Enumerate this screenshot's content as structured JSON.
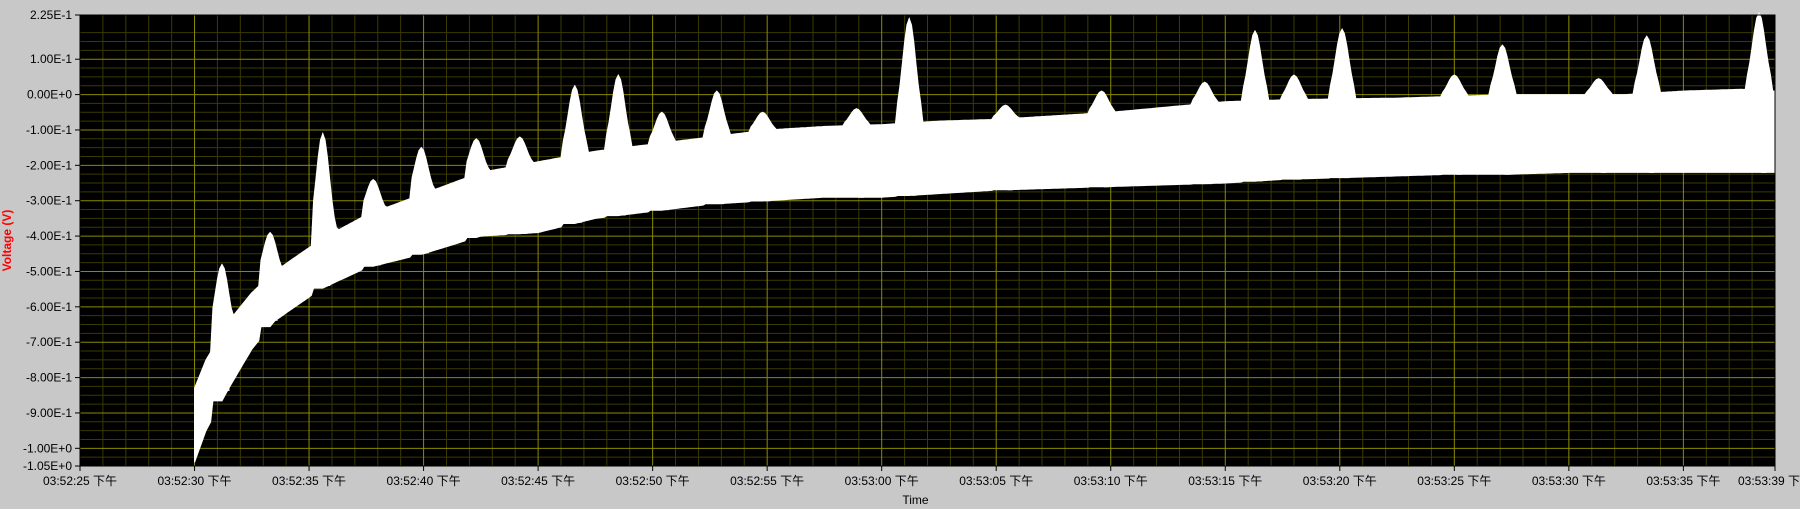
{
  "colors": {
    "background": "#c8c8c8",
    "plot_area": "#000000",
    "grid_major": "#8a8a00",
    "grid_minor": "#3a3a00",
    "trace": "#ffffff",
    "ylabel": "#ff0000",
    "tick_text": "#000000"
  },
  "chart_data": {
    "type": "area",
    "xlabel": "Time",
    "ylabel": "Voltage (V)",
    "x_range_seconds": [
      "03:52:25",
      "03:53:39"
    ],
    "ylim": [
      -1.05,
      0.225
    ],
    "grid": true,
    "y_ticks": [
      {
        "value": 0.225,
        "label": "2.25E-1"
      },
      {
        "value": 0.1,
        "label": "1.00E-1"
      },
      {
        "value": 0.0,
        "label": "0.00E+0"
      },
      {
        "value": -0.1,
        "label": "-1.00E-1"
      },
      {
        "value": -0.2,
        "label": "-2.00E-1"
      },
      {
        "value": -0.3,
        "label": "-3.00E-1"
      },
      {
        "value": -0.4,
        "label": "-4.00E-1"
      },
      {
        "value": -0.5,
        "label": "-5.00E-1"
      },
      {
        "value": -0.6,
        "label": "-6.00E-1"
      },
      {
        "value": -0.7,
        "label": "-7.00E-1"
      },
      {
        "value": -0.8,
        "label": "-8.00E-1"
      },
      {
        "value": -0.9,
        "label": "-9.00E-1"
      },
      {
        "value": -1.0,
        "label": "-1.00E+0"
      },
      {
        "value": -1.05,
        "label": "-1.05E+0"
      }
    ],
    "x_ticks": [
      {
        "time": "03:52:25",
        "label": "03:52:25 下午"
      },
      {
        "time": "03:52:30",
        "label": "03:52:30 下午"
      },
      {
        "time": "03:52:35",
        "label": "03:52:35 下午"
      },
      {
        "time": "03:52:40",
        "label": "03:52:40 下午"
      },
      {
        "time": "03:52:45",
        "label": "03:52:45 下午"
      },
      {
        "time": "03:52:50",
        "label": "03:52:50 下午"
      },
      {
        "time": "03:52:55",
        "label": "03:52:55 下午"
      },
      {
        "time": "03:53:00",
        "label": "03:53:00 下午"
      },
      {
        "time": "03:53:05",
        "label": "03:53:05 下午"
      },
      {
        "time": "03:53:10",
        "label": "03:53:10 下午"
      },
      {
        "time": "03:53:15",
        "label": "03:53:15 下午"
      },
      {
        "time": "03:53:20",
        "label": "03:53:20 下午"
      },
      {
        "time": "03:53:25",
        "label": "03:53:25 下午"
      },
      {
        "time": "03:53:30",
        "label": "03:53:30 下午"
      },
      {
        "time": "03:53:35",
        "label": "03:53:35 下午"
      },
      {
        "time": "03:53:39",
        "label": "03:53:39 下午"
      }
    ],
    "envelope": {
      "t_seconds_from_start": [
        5.0,
        5.5,
        6.5,
        7.5,
        8.5,
        10.5,
        12.5,
        15.0,
        17.5,
        20.0,
        22.5,
        25.0,
        27.5,
        30.0,
        32.5,
        35.0,
        37.5,
        40.0,
        42.5,
        45.0,
        47.5,
        50.0,
        52.5,
        55.0,
        57.5,
        60.0,
        62.5,
        65.0,
        67.5,
        70.0,
        72.5,
        74.0
      ],
      "upper": [
        -0.83,
        -0.75,
        -0.64,
        -0.56,
        -0.5,
        -0.41,
        -0.34,
        -0.28,
        -0.22,
        -0.19,
        -0.16,
        -0.14,
        -0.12,
        -0.1,
        -0.09,
        -0.085,
        -0.075,
        -0.07,
        -0.06,
        -0.05,
        -0.035,
        -0.02,
        -0.015,
        -0.012,
        -0.01,
        -0.005,
        0.0,
        0.0,
        0.0,
        0.01,
        0.015,
        0.01
      ],
      "lower": [
        -1.04,
        -0.95,
        -0.83,
        -0.72,
        -0.64,
        -0.55,
        -0.49,
        -0.45,
        -0.4,
        -0.39,
        -0.35,
        -0.33,
        -0.31,
        -0.3,
        -0.29,
        -0.29,
        -0.28,
        -0.27,
        -0.265,
        -0.26,
        -0.255,
        -0.25,
        -0.24,
        -0.235,
        -0.23,
        -0.225,
        -0.225,
        -0.22,
        -0.22,
        -0.22,
        -0.22,
        -0.22
      ]
    },
    "spikes": [
      {
        "t": 6.2,
        "peak": -0.48
      },
      {
        "t": 8.3,
        "peak": -0.39
      },
      {
        "t": 10.6,
        "peak": -0.11
      },
      {
        "t": 12.8,
        "peak": -0.24
      },
      {
        "t": 14.9,
        "peak": -0.15
      },
      {
        "t": 17.3,
        "peak": -0.125
      },
      {
        "t": 19.2,
        "peak": -0.12
      },
      {
        "t": 21.6,
        "peak": 0.025
      },
      {
        "t": 23.5,
        "peak": 0.055
      },
      {
        "t": 25.4,
        "peak": -0.05
      },
      {
        "t": 27.8,
        "peak": 0.01
      },
      {
        "t": 29.8,
        "peak": -0.05
      },
      {
        "t": 33.9,
        "peak": -0.04
      },
      {
        "t": 36.2,
        "peak": 0.215
      },
      {
        "t": 40.4,
        "peak": -0.03
      },
      {
        "t": 44.6,
        "peak": 0.01
      },
      {
        "t": 49.1,
        "peak": 0.035
      },
      {
        "t": 51.3,
        "peak": 0.18
      },
      {
        "t": 53.0,
        "peak": 0.055
      },
      {
        "t": 55.1,
        "peak": 0.185
      },
      {
        "t": 60.0,
        "peak": 0.055
      },
      {
        "t": 62.1,
        "peak": 0.14
      },
      {
        "t": 66.3,
        "peak": 0.045
      },
      {
        "t": 68.4,
        "peak": 0.165
      },
      {
        "t": 73.3,
        "peak": 0.23
      }
    ]
  }
}
